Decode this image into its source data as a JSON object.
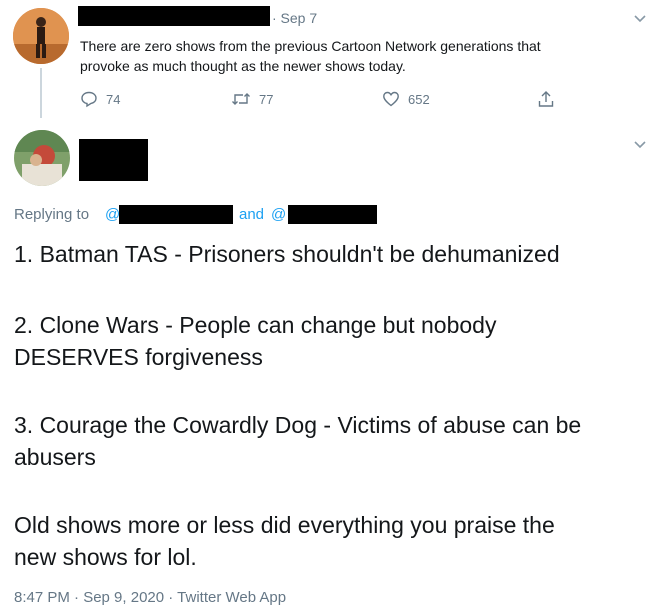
{
  "parent_tweet": {
    "date": "· Sep 7",
    "text_line1": "There are zero shows from the previous Cartoon Network generations that",
    "text_line2": "provoke as much thought as the newer shows today.",
    "reply_count": "74",
    "retweet_count": "77",
    "like_count": "652"
  },
  "main_tweet": {
    "replying_to_prefix": "Replying to",
    "replying_handle_prefix_1": "@",
    "replying_and": "and",
    "replying_handle_prefix_2": "@",
    "line1": "1. Batman TAS - Prisoners shouldn't be dehumanized",
    "line2a": "2. Clone Wars - People can change but nobody",
    "line2b": "DESERVES forgiveness",
    "line3a": "3. Courage the Cowardly Dog - Victims of abuse can be",
    "line3b": "abusers",
    "line4a": "Old shows more or less did everything you praise the",
    "line4b": "new shows for lol.",
    "timestamp": "8:47 PM · Sep 9, 2020 · Twitter Web App"
  },
  "colors": {
    "accent": "#1da1f2",
    "muted": "#657786",
    "text": "#14171a",
    "redaction": "#000000"
  },
  "icons": [
    "reply-icon",
    "retweet-icon",
    "like-icon",
    "share-icon",
    "chevron-down-icon"
  ]
}
